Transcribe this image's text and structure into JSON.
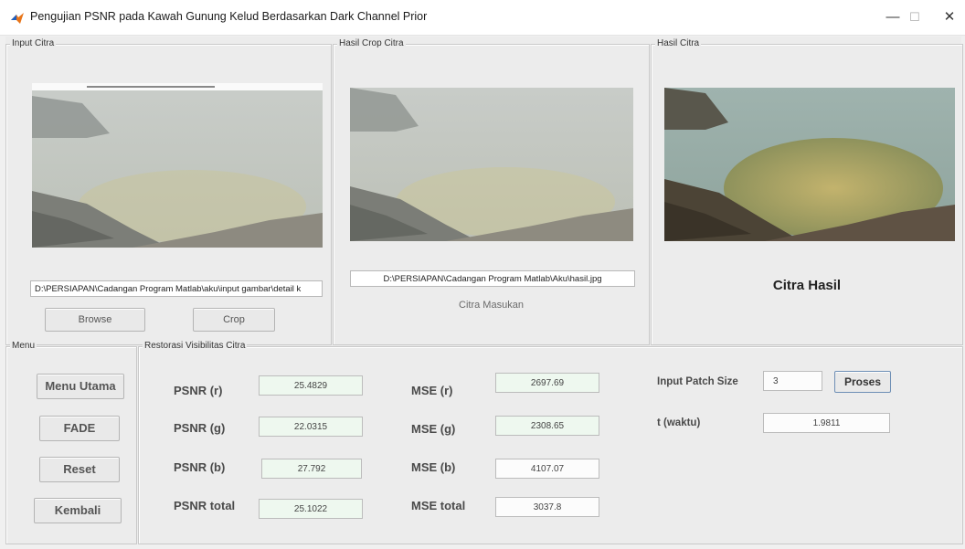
{
  "window": {
    "title": "Pengujian PSNR pada Kawah Gunung Kelud Berdasarkan Dark Channel Prior",
    "minimize": "—",
    "maximize": "☐",
    "close": "✕"
  },
  "panels": {
    "input": {
      "title": "Input Citra",
      "path": "D:\\PERSIAPAN\\Cadangan Program Matlab\\aku\\input gambar\\detail k",
      "browse": "Browse",
      "crop": "Crop"
    },
    "crop": {
      "title": "Hasil Crop Citra",
      "path": "D:\\PERSIAPAN\\Cadangan Program Matlab\\Aku\\hasil.jpg",
      "caption": "Citra Masukan"
    },
    "result": {
      "title": "Hasil Citra",
      "caption": "Citra Hasil"
    }
  },
  "menu": {
    "title": "Menu",
    "items": [
      "Menu Utama",
      "FADE",
      "Reset",
      "Kembali"
    ]
  },
  "restorasi": {
    "title": "Restorasi Visibilitas Citra",
    "psnr": [
      {
        "label": "PSNR (r)",
        "value": "25.4829"
      },
      {
        "label": "PSNR (g)",
        "value": "22.0315"
      },
      {
        "label": "PSNR (b)",
        "value": "27.792"
      },
      {
        "label": "PSNR total",
        "value": "25.1022"
      }
    ],
    "mse": [
      {
        "label": "MSE (r)",
        "value": "2697.69"
      },
      {
        "label": "MSE (g)",
        "value": "2308.65"
      },
      {
        "label": "MSE (b)",
        "value": "4107.07"
      },
      {
        "label": "MSE total",
        "value": "3037.8"
      }
    ],
    "patch_label": "Input Patch Size",
    "patch_value": "3",
    "proses": "Proses",
    "waktu_label": "t (waktu)",
    "waktu_value": "1.9811"
  },
  "colors": {
    "value_box_bg": "#eef8ef",
    "icon_blue": "#1f5fbf",
    "icon_orange": "#e8751a"
  }
}
